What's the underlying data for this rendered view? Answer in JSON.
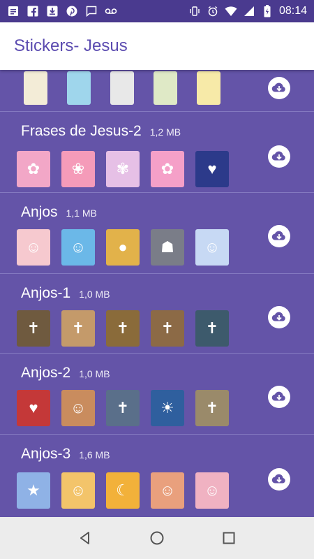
{
  "status_bar": {
    "time": "08:14",
    "left_icons": [
      "message-icon",
      "facebook-icon",
      "download-icon",
      "pinterest-icon",
      "chat-icon",
      "voicemail-icon"
    ],
    "right_icons": [
      "vibrate-icon",
      "alarm-icon",
      "wifi-icon",
      "signal-icon",
      "battery-icon"
    ]
  },
  "app_bar": {
    "title": "Stickers- Jesus"
  },
  "packs": [
    {
      "name": "",
      "size": "",
      "colors": [
        "#f3ecd7",
        "#9fd6ec",
        "#e8e8e8",
        "#dfe9c6",
        "#f7eaa8"
      ]
    },
    {
      "name": "Frases de Jesus-2",
      "size": "1,2 MB",
      "colors": [
        "#f2a7c7",
        "#f59bb9",
        "#e6c0e6",
        "#f5a0c8",
        "#2c3a8a"
      ]
    },
    {
      "name": "Anjos",
      "size": "1,1 MB",
      "colors": [
        "#f6c9cf",
        "#6bb8e8",
        "#e2b24a",
        "#7a7d88",
        "#c7d9f4"
      ]
    },
    {
      "name": "Anjos-1",
      "size": "1,0 MB",
      "colors": [
        "#6f5a3f",
        "#c49a6a",
        "#8a6b3a",
        "#8c6a46",
        "#3d5a6c"
      ]
    },
    {
      "name": "Anjos-2",
      "size": "1,0 MB",
      "colors": [
        "#c43838",
        "#c98c5e",
        "#5a6f8a",
        "#2f5f9e",
        "#9a8a6a"
      ]
    },
    {
      "name": "Anjos-3",
      "size": "1,6 MB",
      "colors": [
        "#8fb2e6",
        "#f3c46a",
        "#f2b13a",
        "#e9a07d",
        "#f0b2c2"
      ]
    }
  ],
  "nav_bar": {
    "icons": [
      "back-icon",
      "home-icon",
      "recents-icon"
    ]
  },
  "colors": {
    "background": "#6454a8",
    "status_bar": "#4a3a8f",
    "title": "#5b4bb0"
  }
}
